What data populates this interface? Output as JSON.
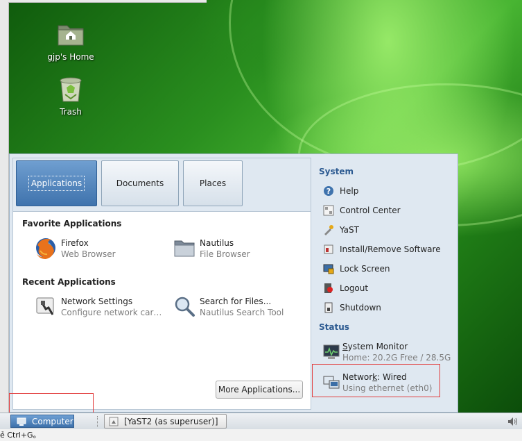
{
  "desktop": {
    "icons": [
      {
        "label": "gjp's Home",
        "icon": "home-folder-icon"
      },
      {
        "label": "Trash",
        "icon": "trash-icon"
      }
    ]
  },
  "menu": {
    "tabs": [
      {
        "label": "Applications",
        "active": true
      },
      {
        "label": "Documents",
        "active": false
      },
      {
        "label": "Places",
        "active": false
      }
    ],
    "favorites_title": "Favorite Applications",
    "favorites": [
      {
        "name": "Firefox",
        "desc": "Web Browser",
        "icon": "firefox-icon"
      },
      {
        "name": "Nautilus",
        "desc": "File Browser",
        "icon": "file-manager-icon"
      }
    ],
    "recent_title": "Recent Applications",
    "recent": [
      {
        "name": "Network Settings",
        "desc": "Configure network car…",
        "icon": "network-settings-icon"
      },
      {
        "name": "Search for Files...",
        "desc": "Nautilus Search Tool",
        "icon": "magnifier-icon"
      }
    ],
    "more_apps": "More Applications...",
    "system_title": "System",
    "system_items": [
      {
        "label": "Help",
        "icon": "help-icon"
      },
      {
        "label": "Control Center",
        "icon": "control-center-icon"
      },
      {
        "label": "YaST",
        "icon": "yast-icon"
      },
      {
        "label": "Install/Remove Software",
        "icon": "software-icon"
      },
      {
        "label": "Lock Screen",
        "icon": "lock-screen-icon"
      },
      {
        "label": "Logout",
        "icon": "logout-icon"
      },
      {
        "label": "Shutdown",
        "icon": "shutdown-icon"
      }
    ],
    "status_title": "Status",
    "status_items": [
      {
        "name_pre": "S",
        "name_ul": "",
        "name_post": "ystem Monitor",
        "full": "System Monitor",
        "desc": "Home: 20.2G Free / 28.5G",
        "icon": "system-monitor-icon"
      },
      {
        "name_pre": "Networ",
        "name_ul": "k",
        "name_post": ": Wired",
        "full": "Network: Wired",
        "desc": "Using ethernet (eth0)",
        "icon": "network-wired-icon"
      }
    ]
  },
  "taskbar": {
    "computer_label": "Computer",
    "task_label": "[YaST2 (as superuser)]"
  },
  "statusline": "ẻ Ctrl+G。",
  "colors": {
    "highlight": "#e23c3c",
    "accent": "#3f73ad"
  }
}
